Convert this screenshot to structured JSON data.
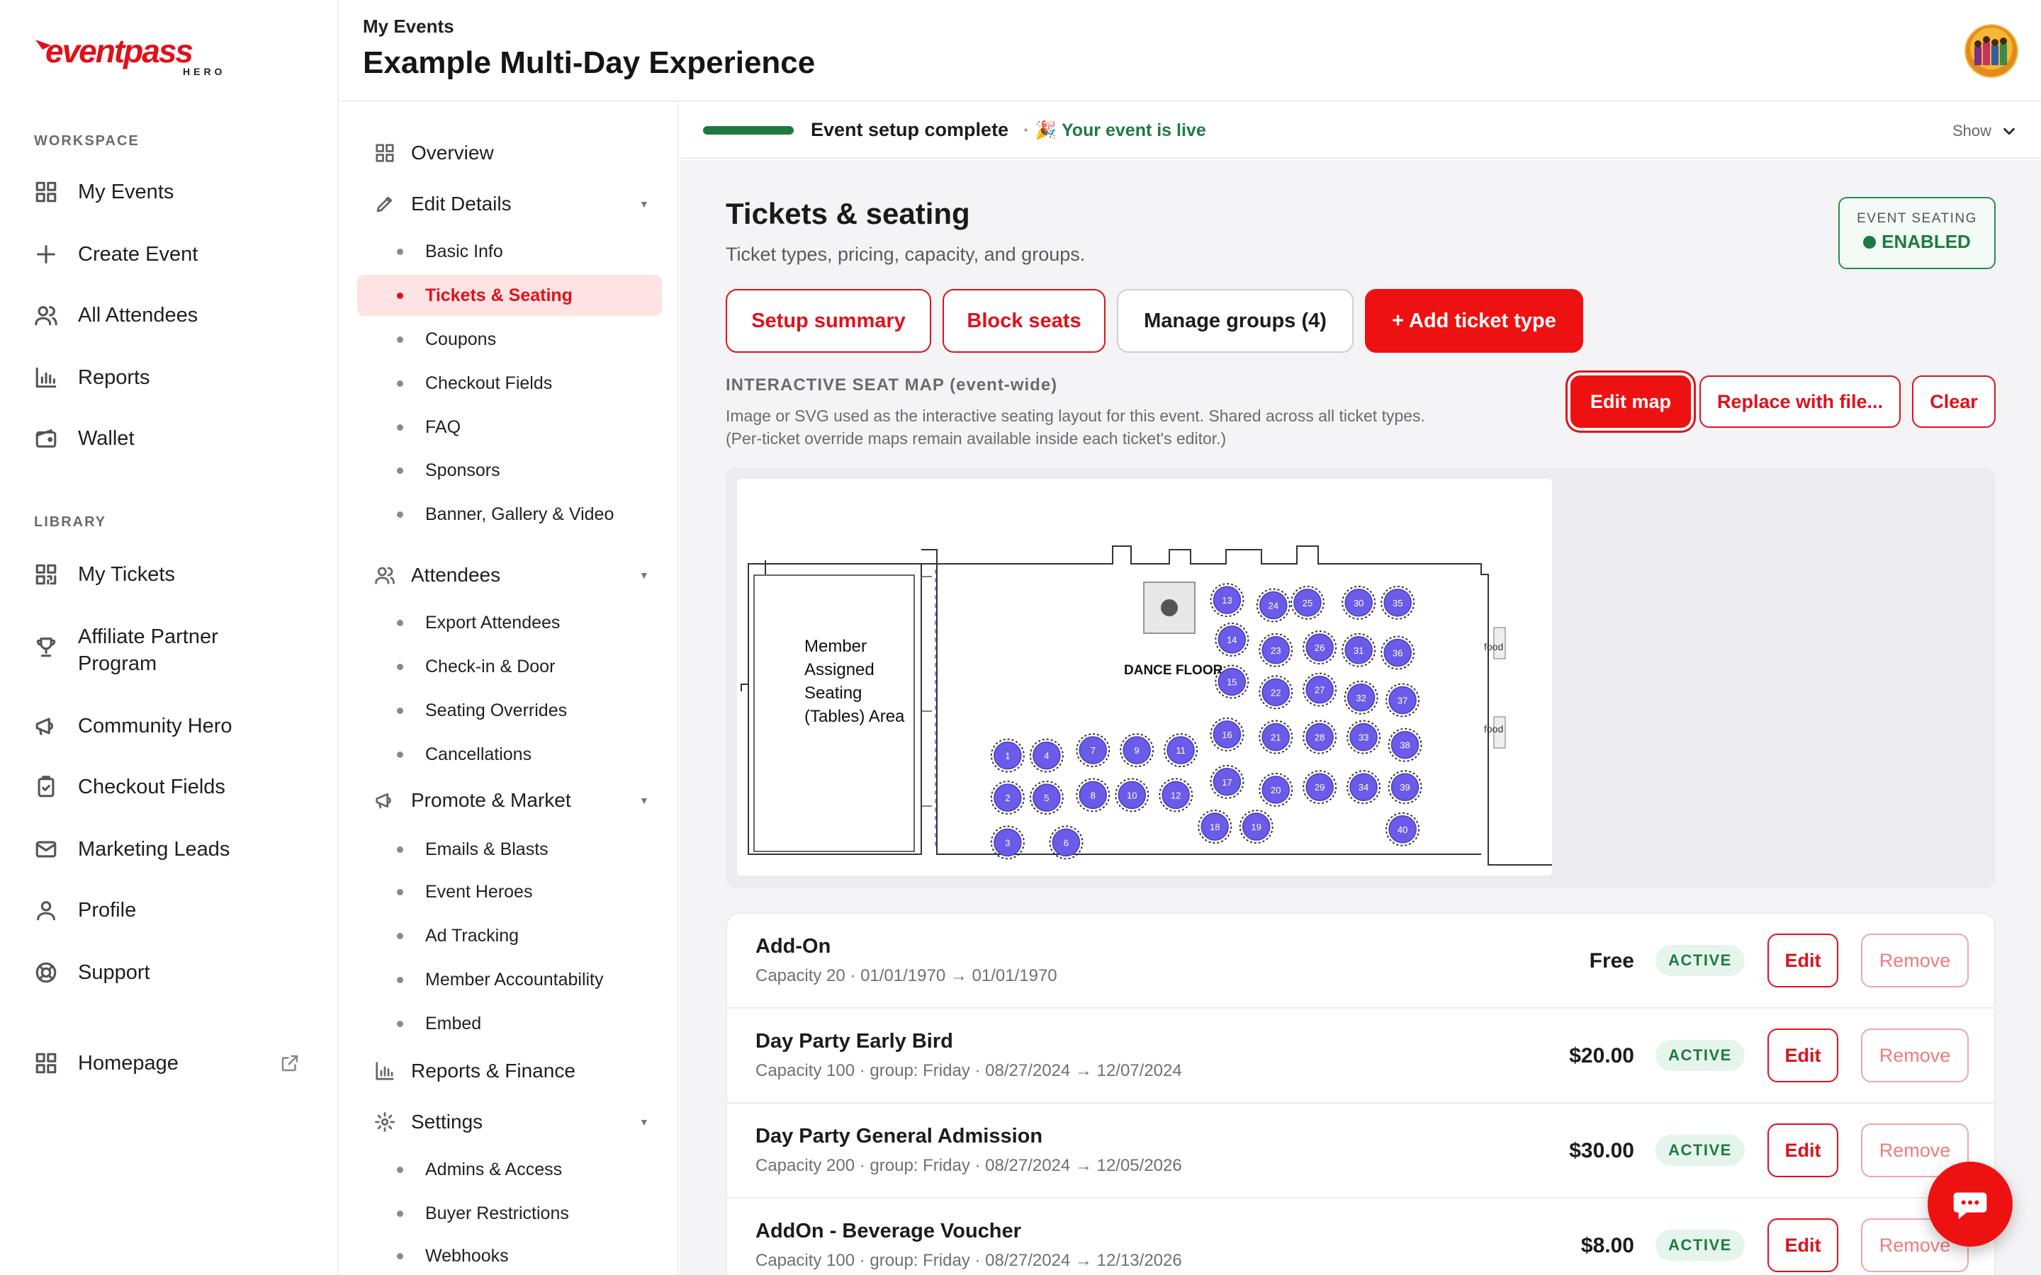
{
  "brand": {
    "logo_main": "eventpass",
    "logo_sub": "HERO",
    "accent": "#EE1111",
    "success": "#1F7A40"
  },
  "sidebar": {
    "workspace_label": "WORKSPACE",
    "workspace_items": [
      {
        "label": "My Events",
        "icon": "grid-icon"
      },
      {
        "label": "Create Event",
        "icon": "plus-icon"
      },
      {
        "label": "All Attendees",
        "icon": "users-icon"
      },
      {
        "label": "Reports",
        "icon": "bar-chart-icon"
      },
      {
        "label": "Wallet",
        "icon": "wallet-icon"
      }
    ],
    "library_label": "LIBRARY",
    "library_items": [
      {
        "label": "My Tickets",
        "icon": "qr-icon"
      },
      {
        "label": "Affiliate Partner Program",
        "line1": "Affiliate Partner",
        "line2": "Program",
        "icon": "trophy-icon"
      },
      {
        "label": "Community Hero",
        "icon": "megaphone-icon"
      },
      {
        "label": "Checkout Fields",
        "icon": "clipboard-icon"
      },
      {
        "label": "Marketing Leads",
        "icon": "mail-icon"
      },
      {
        "label": "Profile",
        "icon": "user-icon"
      },
      {
        "label": "Support",
        "icon": "lifebuoy-icon"
      }
    ],
    "homepage": {
      "label": "Homepage",
      "icon": "grid-icon"
    }
  },
  "header": {
    "breadcrumb": "My Events",
    "title": "Example Multi-Day Experience"
  },
  "subnav": {
    "overview": "Overview",
    "edit_details": "Edit Details",
    "edit_items": [
      "Basic Info",
      "Tickets & Seating",
      "Coupons",
      "Checkout Fields",
      "FAQ",
      "Sponsors",
      "Banner, Gallery & Video"
    ],
    "attendees": "Attendees",
    "attendee_items": [
      "Export Attendees",
      "Check-in & Door",
      "Seating Overrides",
      "Cancellations"
    ],
    "promote": "Promote & Market",
    "promote_items": [
      "Emails & Blasts",
      "Event Heroes",
      "Ad Tracking",
      "Member Accountability",
      "Embed"
    ],
    "reports": "Reports & Finance",
    "settings": "Settings",
    "settings_items": [
      "Admins & Access",
      "Buyer Restrictions",
      "Webhooks"
    ]
  },
  "setup": {
    "status": "Event setup complete",
    "live": "🎉 Your event is live",
    "show": "Show"
  },
  "main": {
    "title": "Tickets & seating",
    "subtitle": "Ticket types, pricing, capacity, and groups.",
    "seating_badge_label": "EVENT SEATING",
    "seating_badge_value": "ENABLED",
    "buttons": {
      "setup_summary": "Setup summary",
      "block_seats": "Block seats",
      "manage_groups": "Manage groups (4)",
      "add_ticket": "+ Add ticket type"
    },
    "seatmap": {
      "label": "INTERACTIVE SEAT MAP (event-wide)",
      "desc1": "Image or SVG used as the interactive seating layout for this event. Shared across all ticket types.",
      "desc2": "(Per-ticket override maps remain available inside each ticket's editor.)",
      "edit": "Edit map",
      "replace": "Replace with file...",
      "clear": "Clear",
      "area_label_lines": [
        "Member",
        "Assigned",
        "Seating",
        "(Tables) Area"
      ],
      "dance_floor": "DANCE FLOOR",
      "food": "food",
      "tables": [
        "1",
        "2",
        "3",
        "4",
        "5",
        "6",
        "7",
        "8",
        "9",
        "10",
        "11",
        "12",
        "13",
        "14",
        "15",
        "16",
        "17",
        "18",
        "19",
        "20",
        "21",
        "22",
        "23",
        "24",
        "25",
        "26",
        "27",
        "28",
        "29",
        "30",
        "31",
        "32",
        "33",
        "34",
        "35",
        "36",
        "37",
        "38",
        "39",
        "40"
      ]
    },
    "tickets": [
      {
        "name": "Add-On",
        "meta": "Capacity 20 · 01/01/1970 → 01/01/1970",
        "price": "Free",
        "status": "ACTIVE"
      },
      {
        "name": "Day Party Early Bird",
        "meta": "Capacity 100 · group: Friday · 08/27/2024 → 12/07/2024",
        "price": "$20.00",
        "status": "ACTIVE"
      },
      {
        "name": "Day Party General Admission",
        "meta": "Capacity 200 · group: Friday · 08/27/2024 → 12/05/2026",
        "price": "$30.00",
        "status": "ACTIVE"
      },
      {
        "name": "AddOn - Beverage Voucher",
        "meta": "Capacity 100 · group: Friday · 08/27/2024 → 12/13/2026",
        "price": "$8.00",
        "status": "ACTIVE"
      }
    ],
    "row_edit": "Edit",
    "row_remove": "Remove"
  }
}
